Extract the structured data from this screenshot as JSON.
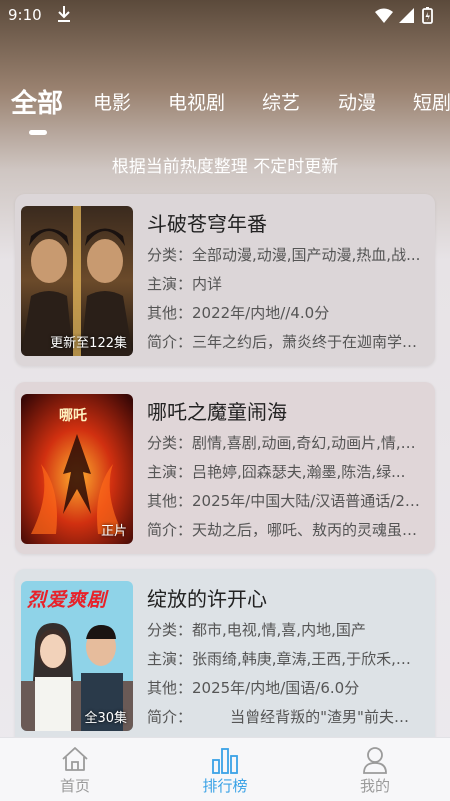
{
  "status_bar": {
    "time": "9:10"
  },
  "tabs": [
    {
      "label": "全部",
      "active": true
    },
    {
      "label": "电影"
    },
    {
      "label": "电视剧"
    },
    {
      "label": "综艺"
    },
    {
      "label": "动漫"
    },
    {
      "label": "短剧"
    }
  ],
  "subtitle": "根据当前热度整理 不定时更新",
  "items": [
    {
      "title": "斗破苍穹年番",
      "badge": "更新至122集",
      "category": "分类：全部动漫,动漫,国产动漫,热血,战...",
      "cast": "主演：内详",
      "other": "其他：2022年/内地//4.0分",
      "intro": "简介：三年之约后，萧炎终于在迦南学院..."
    },
    {
      "title": "哪吒之魔童闹海",
      "badge": "正片",
      "category": "分类：剧情,喜剧,动画,奇幻,动画片,情,喜...",
      "cast": "主演：吕艳婷,囧森瑟夫,瀚墨,陈浩,绿...",
      "other": "其他：2025年/中国大陆/汉语普通话/2.0...",
      "intro": "简介：天劫之后，哪吒、敖丙的灵魂虽保..."
    },
    {
      "title": "绽放的许开心",
      "badge": "全30集",
      "category": "分类：都市,电视,情,喜,内地,国产",
      "cast": "主演：张雨绮,韩庚,章涛,王西,于欣禾,江...",
      "other": "其他：2025年/内地/国语/6.0分",
      "intro": "简介：        当曾经背叛的\"渣男\"前夫和假..."
    }
  ],
  "poster3_text": "烈爱爽剧",
  "nav": [
    {
      "label": "首页",
      "icon": "home-icon"
    },
    {
      "label": "排行榜",
      "icon": "ranking-icon",
      "active": true
    },
    {
      "label": "我的",
      "icon": "profile-icon"
    }
  ],
  "colors": {
    "accent": "#3aa2e6",
    "inactive": "#9b9b9b"
  }
}
